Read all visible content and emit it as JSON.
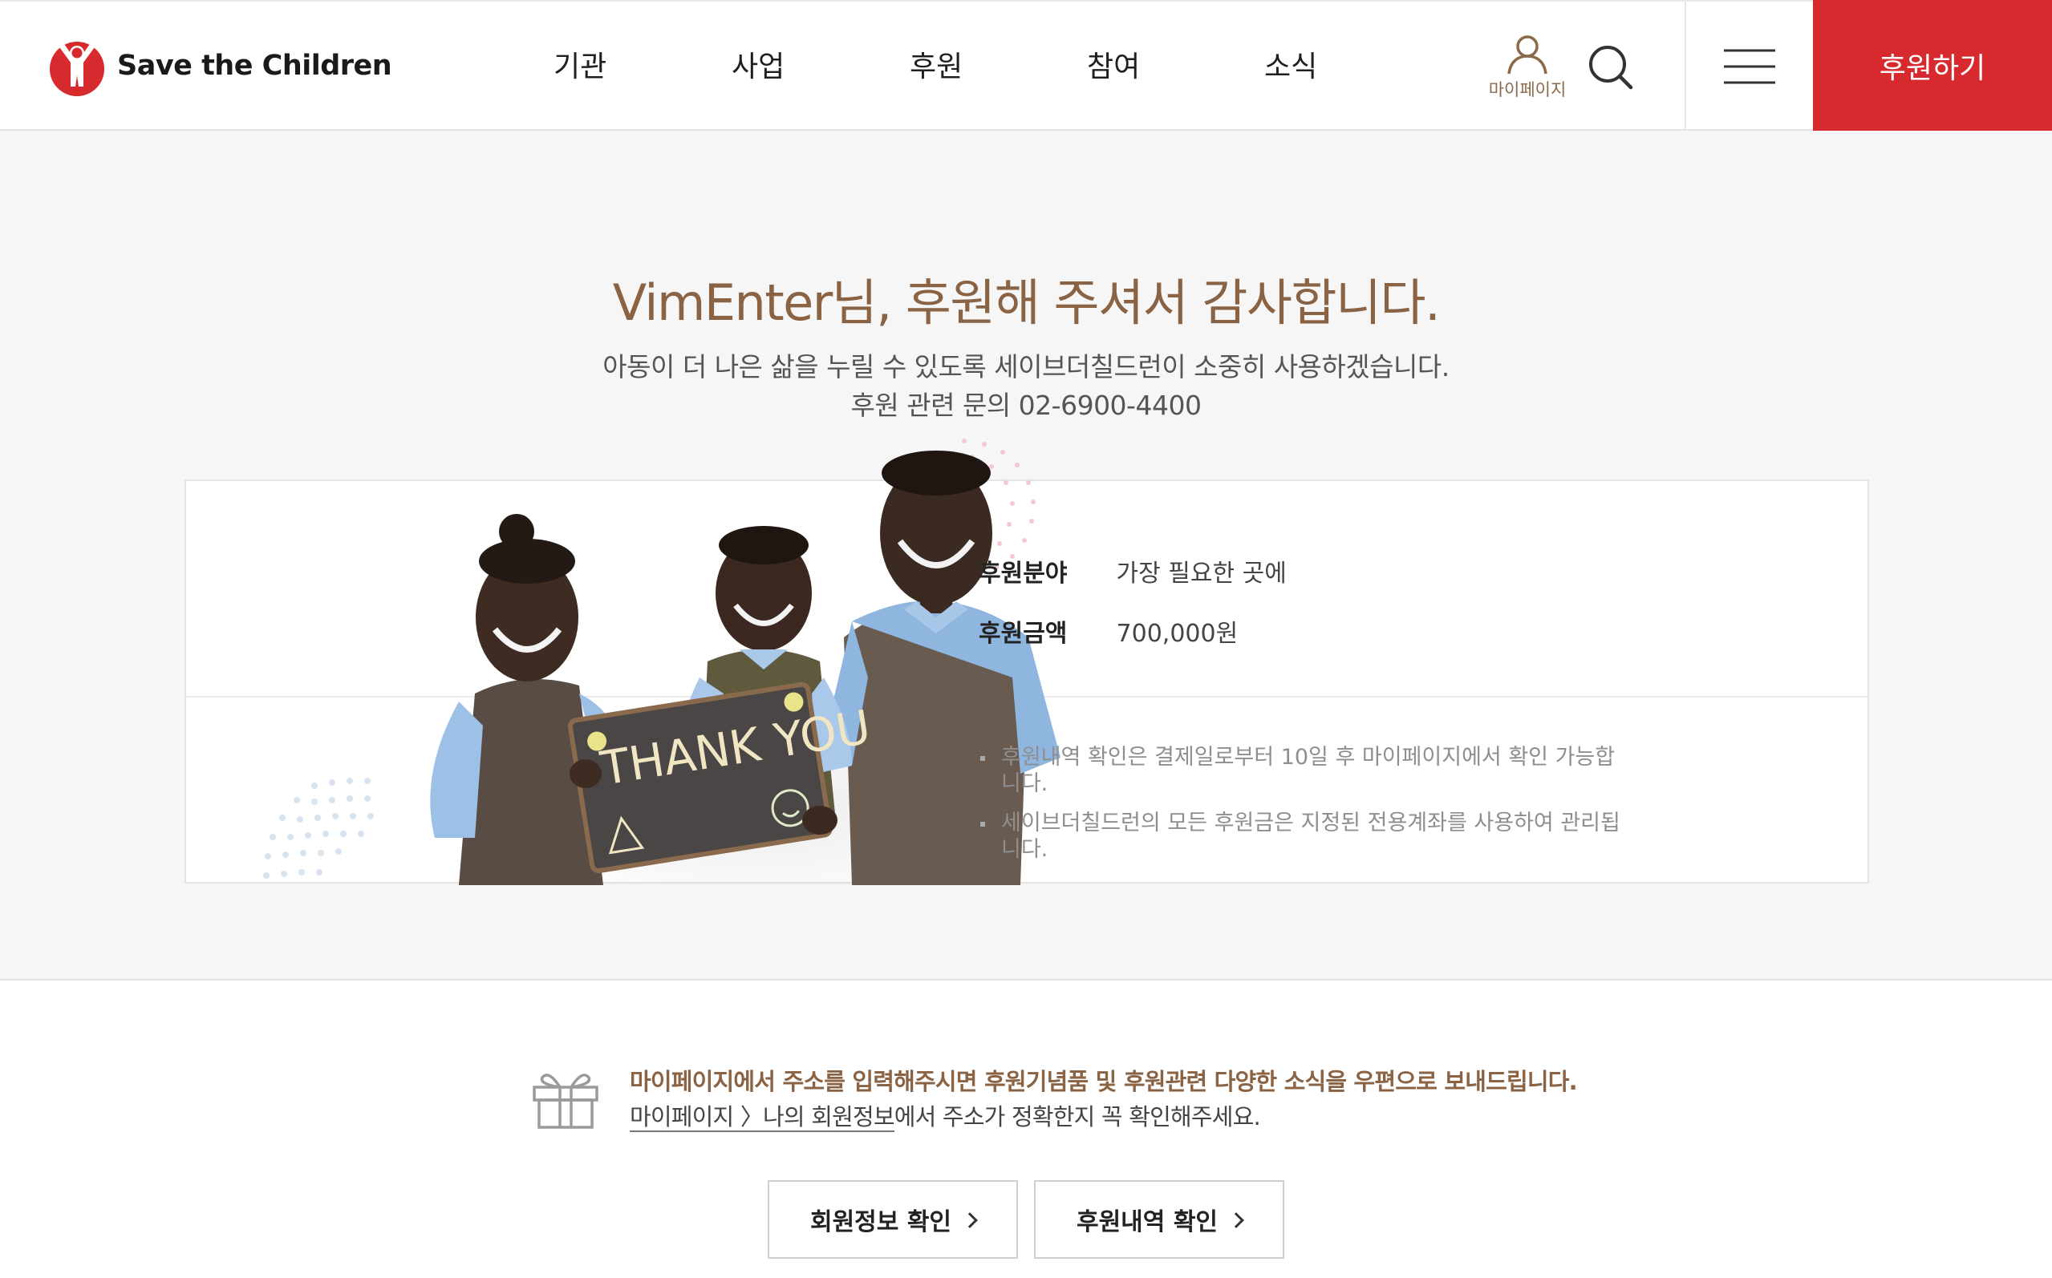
{
  "header": {
    "logo_text": "Save the Children",
    "nav": [
      "기관",
      "사업",
      "후원",
      "참여",
      "소식"
    ],
    "mypage_label": "마이페이지",
    "donate_label": "후원하기"
  },
  "hero": {
    "title": "VimEnter님, 후원해 주셔서 감사합니다.",
    "subtitle": "아동이 더 나은 삶을 누릴 수 있도록 세이브더칠드런이 소중히 사용하겠습니다.",
    "contact": "후원 관련 문의  02-6900-4400"
  },
  "card": {
    "sign_text": "THANK YOU",
    "rows": [
      {
        "label": "후원분야",
        "value": "가장 필요한 곳에"
      },
      {
        "label": "후원금액",
        "value": "700,000원"
      }
    ],
    "notes": [
      "후원내역 확인은 결제일로부터 10일 후 마이페이지에서 확인 가능합니다.",
      "세이브더칠드런의 모든 후원금은 지정된 전용계좌를 사용하여 관리됩니다."
    ]
  },
  "notice": {
    "strong": "마이페이지에서 주소를 입력해주시면 후원기념품 및 후원관련 다양한 소식을 우편으로 보내드립니다.",
    "link": "마이페이지 〉나의 회원정보",
    "rest": "에서 주소가 정확한지 꼭 확인해주세요."
  },
  "buttons": {
    "member_info": "회원정보 확인",
    "donation_history": "후원내역 확인"
  },
  "colors": {
    "brand_red": "#d72a2e",
    "accent_brown": "#8a6344",
    "hero_bg": "#f6f6f6"
  }
}
